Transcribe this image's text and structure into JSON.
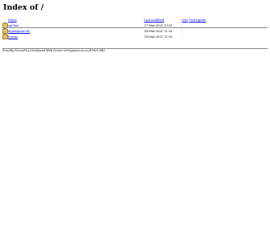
{
  "page": {
    "title": "Index of /"
  },
  "table": {
    "headers": {
      "name": "Name",
      "last_modified": "Last modified",
      "size": "Size",
      "description": "Description"
    },
    "rows": [
      {
        "icon": "folder-icon",
        "name": "cgi-bin/",
        "last_modified": "17-Mar-2021 19:55",
        "size": "-"
      },
      {
        "icon": "folder-icon",
        "name": "digitalprint-sb/",
        "last_modified": "14-Mar-2021 11:16",
        "size": "-"
      },
      {
        "icon": "folder-icon",
        "name": "forum/",
        "last_modified": "14-Mar-2021 11:16",
        "size": "-"
      }
    ]
  },
  "footer": {
    "address": "Proudly Served by LiteSpeed Web Server at koyosea.co.co.jk Port 443"
  }
}
